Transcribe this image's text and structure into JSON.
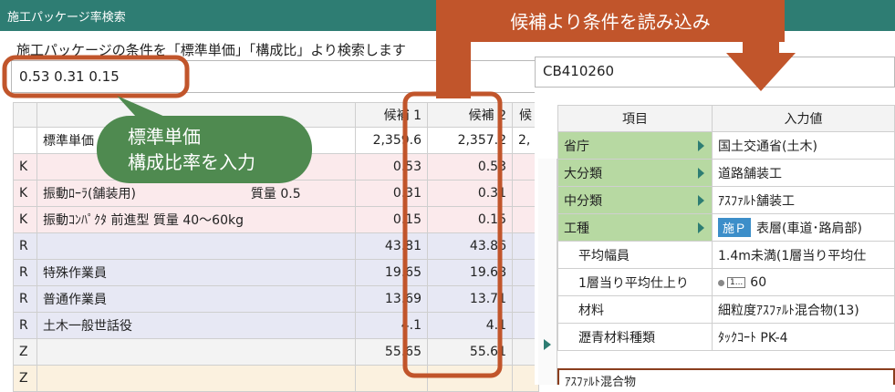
{
  "window": {
    "title": "施工パッケージ率検索"
  },
  "description": "施工パッケージの条件を「標準単価」「構成比」より検索します",
  "search": {
    "value": "0.53 0.31 0.15"
  },
  "grid": {
    "headers": [
      "",
      "",
      "候補 1",
      "候補 2",
      "候"
    ],
    "rows": [
      [
        "",
        "標準単価",
        "2,359.6",
        "2,357.2",
        "2,"
      ],
      [
        "K",
        "",
        "0.53",
        "0.53",
        ""
      ],
      [
        "K",
        "振動ﾛｰﾗ(舗装用)　　　　　　　　　質量 0.5",
        "0.31",
        "0.31",
        ""
      ],
      [
        "K",
        "振動ｺﾝﾊﾟｸﾀ 前進型 質量 40〜60kg",
        "0.15",
        "0.15",
        ""
      ],
      [
        "R",
        "",
        "43.81",
        "43.86",
        ""
      ],
      [
        "R",
        "特殊作業員",
        "19.65",
        "19.68",
        ""
      ],
      [
        "R",
        "普通作業員",
        "13.69",
        "13.71",
        ""
      ],
      [
        "R",
        "土木一般世話役",
        "4.1",
        "4.1",
        ""
      ],
      [
        "Z",
        "",
        "55.65",
        "55.61",
        ""
      ],
      [
        "Z",
        "",
        "",
        "",
        ""
      ]
    ]
  },
  "candidate_code": "CB410260",
  "property_table": {
    "headers": [
      "項目",
      "入力値"
    ],
    "rows": [
      {
        "label": "省庁",
        "value": "国土交通省(土木)"
      },
      {
        "label": "大分類",
        "value": "道路舗装工"
      },
      {
        "label": "中分類",
        "value": "ｱｽﾌｧﾙﾄ舗装工"
      },
      {
        "label": "工種",
        "badge": "施Ｐ",
        "value": "表層(車道･路肩部)"
      },
      {
        "label": "平均幅員",
        "value": "1.4m未満(1層当り平均仕"
      },
      {
        "label": "1層当り平均仕上り",
        "icon_text": "1...",
        "value": "60"
      },
      {
        "label": "材料",
        "value": "細粒度ｱｽﾌｧﾙﾄ混合物(13)"
      },
      {
        "label": "瀝青材料種類",
        "value": "ﾀｯｸｺｰﾄ PK-4"
      }
    ],
    "next_label": "ｱｽﾌｧﾙﾄ混合物"
  },
  "callouts": {
    "bubble_line1": "標準単価",
    "bubble_line2": "構成比率を入力",
    "banner": "候補より条件を読み込み"
  },
  "colors": {
    "titlebar": "#2e7d73",
    "callout_green": "#4f8a50",
    "callout_orange": "#c1552b",
    "label_green": "#b7d9a2"
  }
}
